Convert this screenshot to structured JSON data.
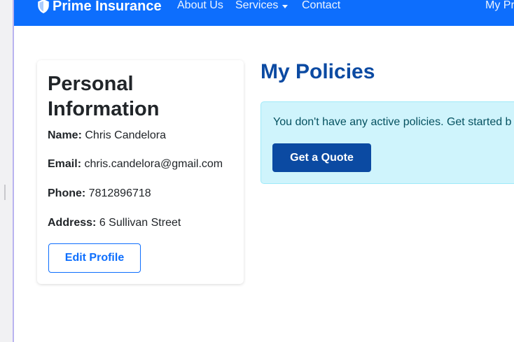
{
  "nav": {
    "brand": "Prime Insurance",
    "about": "About Us",
    "services": "Services",
    "contact": "Contact",
    "my_profile_partial": "My Pr"
  },
  "profile": {
    "title": "Personal Information",
    "name_label": "Name:",
    "name_value": "Chris Candelora",
    "email_label": "Email:",
    "email_value": "chris.candelora@gmail.com",
    "phone_label": "Phone:",
    "phone_value": "7812896718",
    "address_label": "Address:",
    "address_value": "6 Sullivan Street",
    "edit_button": "Edit Profile"
  },
  "policies": {
    "title": "My Policies",
    "empty_message": "You don't have any active policies. Get started b",
    "quote_button": "Get a Quote"
  },
  "colors": {
    "navbar": "#0d6efd",
    "title_blue": "#0b4aa2",
    "alert_bg": "#cff4fc",
    "alert_text": "#055160"
  },
  "icons": {
    "brand": "shield-icon",
    "services_dropdown": "caret-down-icon"
  }
}
